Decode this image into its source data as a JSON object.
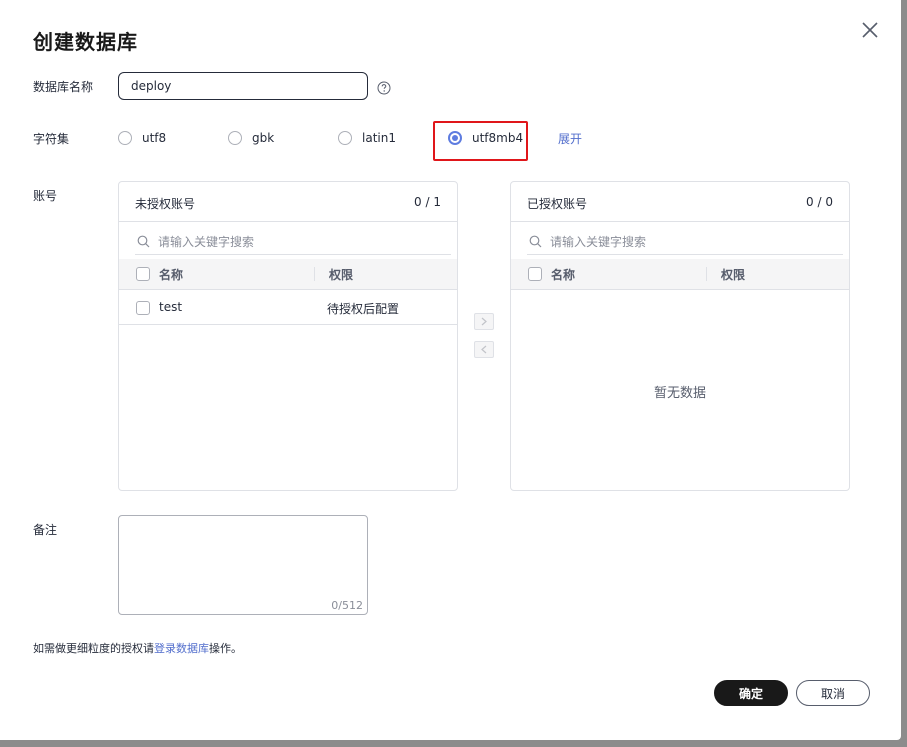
{
  "dialog": {
    "title": "创建数据库",
    "close_icon": "close-icon"
  },
  "form": {
    "db_name": {
      "label": "数据库名称",
      "value": "deploy",
      "help_icon": "question-circle-icon"
    },
    "charset": {
      "label": "字符集",
      "options": [
        "utf8",
        "gbk",
        "latin1",
        "utf8mb4"
      ],
      "selected": "utf8mb4",
      "expand_label": "展开",
      "highlight_color": "#e0161a"
    },
    "account": {
      "label": "账号"
    },
    "remark": {
      "label": "备注",
      "value": "",
      "count": "0/512"
    }
  },
  "unauthorized": {
    "title": "未授权账号",
    "count": "0 / 1",
    "search_placeholder": "请输入关键字搜索",
    "columns": [
      "名称",
      "权限"
    ],
    "rows": [
      {
        "name": "test",
        "permission": "待授权后配置"
      }
    ]
  },
  "authorized": {
    "title": "已授权账号",
    "count": "0 / 0",
    "search_placeholder": "请输入关键字搜索",
    "columns": [
      "名称",
      "权限"
    ],
    "empty_text": "暂无数据"
  },
  "footer": {
    "note_prefix": "如需做更细粒度的授权请",
    "note_link": "登录数据库",
    "note_suffix": "操作。",
    "ok_label": "确定",
    "cancel_label": "取消"
  },
  "colors": {
    "accent": "#5e7ce0",
    "link": "#526ecc",
    "primary_button": "#191919"
  }
}
